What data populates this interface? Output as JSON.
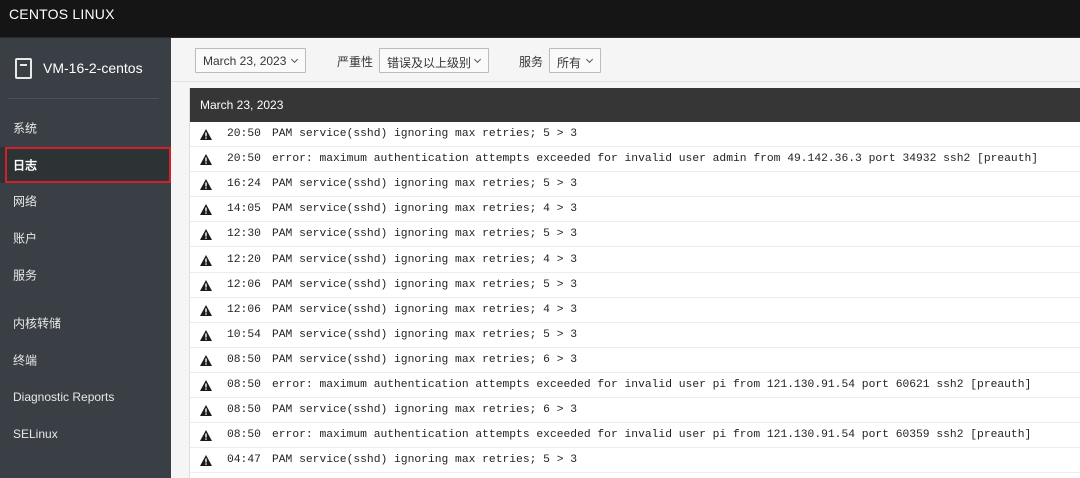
{
  "topbar": {
    "brand": "CENTOS LINUX"
  },
  "sidebar": {
    "host": "VM-16-2-centos",
    "items": [
      {
        "label": "系统",
        "active": false
      },
      {
        "label": "日志",
        "active": true
      },
      {
        "label": "网络",
        "active": false
      },
      {
        "label": "账户",
        "active": false
      },
      {
        "label": "服务",
        "active": false
      },
      {
        "label": "内核转储",
        "active": false
      },
      {
        "label": "终端",
        "active": false
      },
      {
        "label": "Diagnostic Reports",
        "active": false
      },
      {
        "label": "SELinux",
        "active": false
      }
    ]
  },
  "toolbar": {
    "date_value": "March 23, 2023",
    "severity_label": "严重性",
    "severity_value": "错误及以上级别",
    "service_label": "服务",
    "service_value": "所有"
  },
  "logs": {
    "day": "March 23, 2023",
    "icon": "warning-triangle-icon",
    "entries": [
      {
        "time": "20:50",
        "message": "PAM service(sshd) ignoring max retries; 5 > 3"
      },
      {
        "time": "20:50",
        "message": "error: maximum authentication attempts exceeded for invalid user admin from 49.142.36.3 port 34932 ssh2 [preauth]"
      },
      {
        "time": "16:24",
        "message": "PAM service(sshd) ignoring max retries; 5 > 3"
      },
      {
        "time": "14:05",
        "message": "PAM service(sshd) ignoring max retries; 4 > 3"
      },
      {
        "time": "12:30",
        "message": "PAM service(sshd) ignoring max retries; 5 > 3"
      },
      {
        "time": "12:20",
        "message": "PAM service(sshd) ignoring max retries; 4 > 3"
      },
      {
        "time": "12:06",
        "message": "PAM service(sshd) ignoring max retries; 5 > 3"
      },
      {
        "time": "12:06",
        "message": "PAM service(sshd) ignoring max retries; 4 > 3"
      },
      {
        "time": "10:54",
        "message": "PAM service(sshd) ignoring max retries; 5 > 3"
      },
      {
        "time": "08:50",
        "message": "PAM service(sshd) ignoring max retries; 6 > 3"
      },
      {
        "time": "08:50",
        "message": "error: maximum authentication attempts exceeded for invalid user pi from 121.130.91.54 port 60621 ssh2 [preauth]"
      },
      {
        "time": "08:50",
        "message": "PAM service(sshd) ignoring max retries; 6 > 3"
      },
      {
        "time": "08:50",
        "message": "error: maximum authentication attempts exceeded for invalid user pi from 121.130.91.54 port 60359 ssh2 [preauth]"
      },
      {
        "time": "04:47",
        "message": "PAM service(sshd) ignoring max retries; 5 > 3"
      }
    ]
  }
}
